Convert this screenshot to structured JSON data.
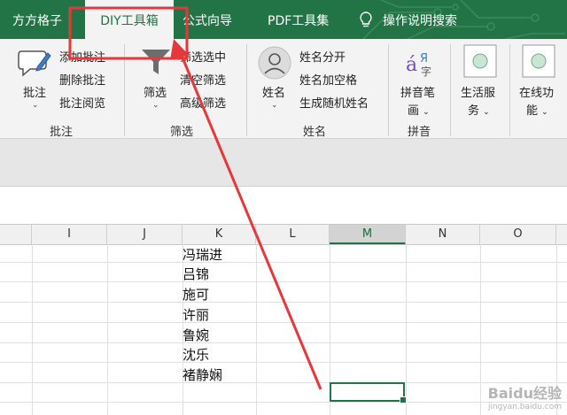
{
  "colors": {
    "accent": "#227447",
    "annotation": "#e8373b"
  },
  "tabs": [
    {
      "label": "方方格子",
      "active": false
    },
    {
      "label": "DIY工具箱",
      "active": true
    },
    {
      "label": "公式向导",
      "active": false
    },
    {
      "label": "PDF工具集",
      "active": false
    },
    {
      "label": "操作说明搜索",
      "active": false,
      "icon": "lightbulb-icon"
    }
  ],
  "ribbon": {
    "comment_group": {
      "label": "批注",
      "main_button": "批注",
      "items": [
        "添加批注",
        "删除批注",
        "批注阅览"
      ]
    },
    "filter_group": {
      "label": "筛选",
      "main_button": "筛选",
      "items": [
        "筛选选中",
        "清空筛选",
        "高级筛选"
      ]
    },
    "name_group": {
      "label": "姓名",
      "main_button": "姓名",
      "items": [
        "姓名分开",
        "姓名加空格",
        "生成随机姓名"
      ]
    },
    "pinyin_group": {
      "label": "拼音",
      "main_button_line1": "拼音笔",
      "main_button_line2": "画"
    },
    "life_group": {
      "line1": "生活服",
      "line2": "务"
    },
    "online_group": {
      "line1": "在线功",
      "line2": "能"
    }
  },
  "columns": [
    "I",
    "J",
    "K",
    "L",
    "M",
    "N",
    "O"
  ],
  "selected_column": "M",
  "cells_k": [
    "冯瑞进",
    "吕锦",
    "施可",
    "许丽",
    "鲁婉",
    "沈乐",
    "褚静娴"
  ],
  "watermark": {
    "brand": "Baidu经验",
    "url": "jingyan.baidu.com"
  }
}
